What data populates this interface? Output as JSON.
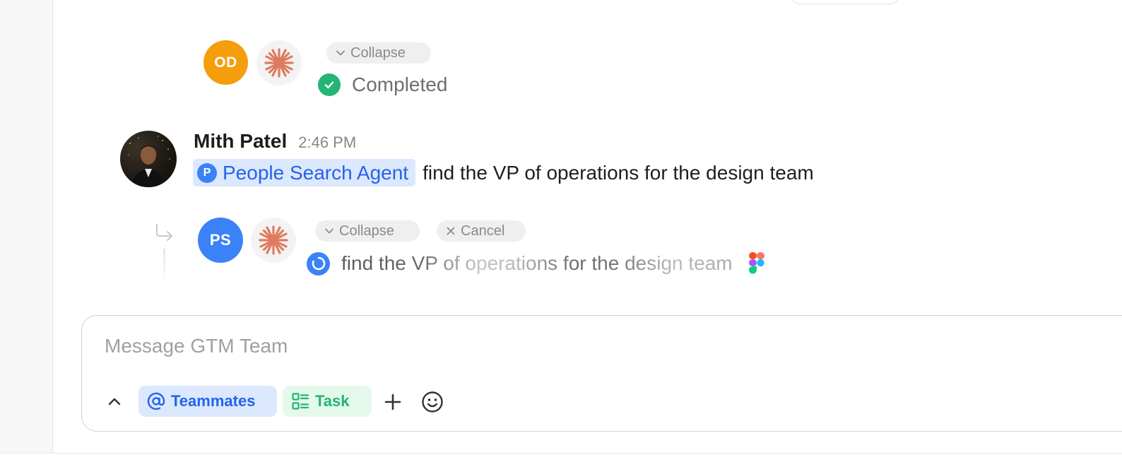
{
  "agent_run_1": {
    "avatar_initials": "OD",
    "collapse_label": "Collapse",
    "status": "Completed"
  },
  "message": {
    "author": "Mith Patel",
    "timestamp": "2:46 PM",
    "mention_badge": "P",
    "mention_label": "People Search Agent",
    "text": "find the VP of operations for the design team"
  },
  "agent_run_2": {
    "avatar_initials": "PS",
    "collapse_label": "Collapse",
    "cancel_label": "Cancel",
    "progress_text": "find the VP of operations for the design team"
  },
  "composer": {
    "placeholder": "Message GTM Team",
    "teammates_label": "Teammates",
    "task_label": "Task"
  },
  "colors": {
    "od_avatar": "#f59e0b",
    "ps_avatar": "#3b82f6",
    "success": "#22b573",
    "mention_bg": "#dce8fd",
    "mention_text": "#2563eb",
    "claude_accent": "#e07a5f"
  },
  "icons": {
    "claude": "claude-asterisk-icon",
    "check": "check-circle-icon",
    "spinner": "spinner-icon",
    "figma": "figma-icon",
    "at": "at-sign-icon",
    "task": "task-list-icon",
    "plus": "plus-icon",
    "emoji": "emoji-icon",
    "chevron_up": "chevron-up-icon",
    "chevron_down": "chevron-down-icon",
    "close": "close-icon",
    "thread": "thread-reply-arrow-icon"
  }
}
